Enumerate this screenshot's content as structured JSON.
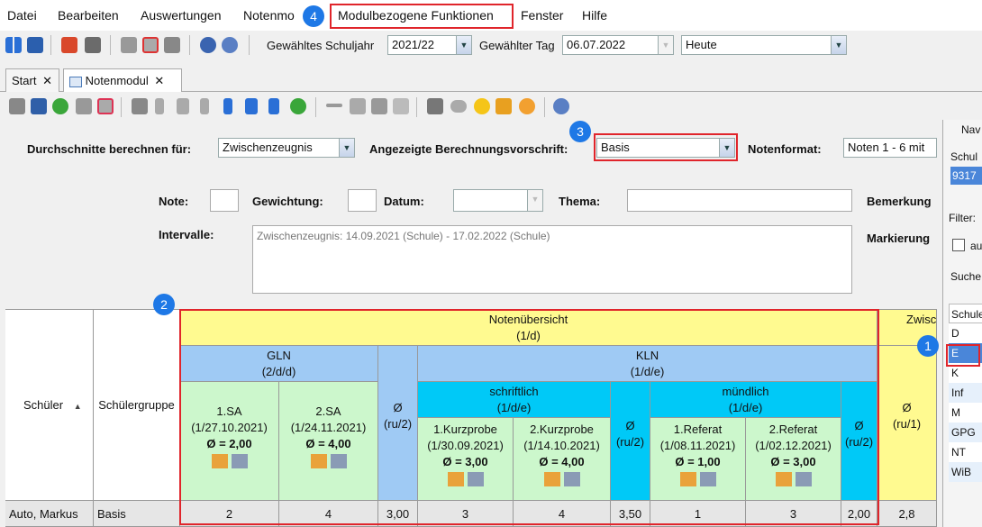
{
  "menu": {
    "items": [
      {
        "label": "Datei"
      },
      {
        "label": "Bearbeiten"
      },
      {
        "label": "Auswertungen"
      },
      {
        "label": "Notenmo"
      },
      {
        "label": "Modulbezogene Funktionen"
      },
      {
        "label": "Fenster"
      },
      {
        "label": "Hilfe"
      }
    ]
  },
  "toolbar": {
    "schuljahr_label": "Gewähltes Schuljahr",
    "schuljahr_value": "2021/22",
    "tag_label": "Gewählter Tag",
    "tag_value": "06.07.2022",
    "heute_value": "Heute"
  },
  "tabs": [
    {
      "label": "Start"
    },
    {
      "label": "Notenmodul"
    }
  ],
  "form": {
    "durchschnitte_label": "Durchschnitte berechnen für:",
    "durchschnitte_value": "Zwischenzeugnis",
    "berechnung_label": "Angezeigte Berechnungsvorschrift:",
    "berechnung_value": "Basis",
    "notenformat_label": "Notenformat:",
    "notenformat_value": "Noten 1 - 6 mit",
    "note_label": "Note:",
    "gewichtung_label": "Gewichtung:",
    "datum_label": "Datum:",
    "thema_label": "Thema:",
    "bemerkung_label": "Bemerkung",
    "intervalle_label": "Intervalle:",
    "intervalle_value": "Zwischenzeugnis: 14.09.2021 (Schule) - 17.02.2022 (Schule)",
    "markierung_label": "Markierung"
  },
  "rightpane": {
    "nav_label": "Nav",
    "schul_label": "Schul",
    "schul_value": "9317",
    "filter_label": "Filter:",
    "checkbox_label": "au",
    "suche_label": "Suche",
    "list_header": "Schule",
    "list_items": [
      "D",
      "E",
      "K",
      "Inf",
      "M",
      "GPG",
      "NT",
      "WiB"
    ]
  },
  "grid": {
    "schueler_header": "Schüler",
    "gruppe_header": "Schülergruppe",
    "notenuebersicht": "Notenübersicht",
    "notenuebersicht_sub": "(1/d)",
    "zwischen_header": "Zwisc",
    "gln": "GLN",
    "gln_sub": "(2/d/d)",
    "kln": "KLN",
    "kln_sub": "(1/d/e)",
    "avg_symbol": "Ø",
    "ru2": "(ru/2)",
    "ru1": "(ru/1)",
    "schriftlich": "schriftlich",
    "schriftlich_sub": "(1/d/e)",
    "muendlich": "mündlich",
    "muendlich_sub": "(1/d/e)",
    "sa1": {
      "name": "1.SA",
      "sub": "(1/27.10.2021)",
      "avg": "Ø = 2,00"
    },
    "sa2": {
      "name": "2.SA",
      "sub": "(1/24.11.2021)",
      "avg": "Ø = 4,00"
    },
    "kp1": {
      "name": "1.Kurzprobe",
      "sub": "(1/30.09.2021)",
      "avg": "Ø = 3,00"
    },
    "kp2": {
      "name": "2.Kurzprobe",
      "sub": "(1/14.10.2021)",
      "avg": "Ø = 4,00"
    },
    "ref1": {
      "name": "1.Referat",
      "sub": "(1/08.11.2021)",
      "avg": "Ø = 1,00"
    },
    "ref2": {
      "name": "2.Referat",
      "sub": "(1/02.12.2021)",
      "avg": "Ø = 3,00"
    },
    "row": {
      "name": "Auto, Markus",
      "gruppe": "Basis",
      "sa1": "2",
      "sa2": "4",
      "gln_avg": "3,00",
      "kp1": "3",
      "kp2": "4",
      "schr_avg": "3,50",
      "ref1": "1",
      "ref2": "3",
      "muend_avg": "2,00",
      "zwischen": "2,8"
    }
  },
  "badges": [
    "1",
    "2",
    "3",
    "4"
  ],
  "colors": {
    "highlight_red": "#e0252b",
    "badge_blue": "#1e78e6",
    "yellow": "#fffa90",
    "blue": "#9fcaf4",
    "cyan": "#00c9f7",
    "green": "#ccf7cc"
  }
}
